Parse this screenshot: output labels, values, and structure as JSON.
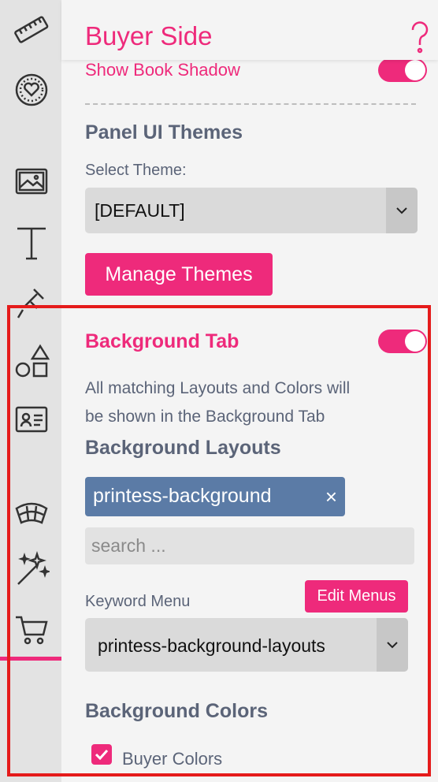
{
  "header": {
    "title": "Buyer Side"
  },
  "sidebar": {
    "icons": [
      "ruler-icon",
      "heart-badge-icon",
      "image-icon",
      "text-icon",
      "pin-icon",
      "shapes-icon",
      "id-card-icon",
      "arch-icon",
      "magic-wand-icon",
      "cart-icon"
    ],
    "active": "cart-icon"
  },
  "settings": {
    "book_shadow": {
      "label": "Show Book Shadow",
      "enabled": true
    },
    "panel_themes": {
      "title": "Panel UI Themes",
      "select_label": "Select Theme:",
      "selected": "[DEFAULT]",
      "manage_button": "Manage Themes"
    },
    "background_tab": {
      "label": "Background Tab",
      "enabled": true,
      "description_line1": "All matching Layouts and Colors will",
      "description_line2": "be shown in the Background Tab"
    },
    "background_layouts": {
      "title": "Background Layouts",
      "chip": "printess-background",
      "chip_remove": "×",
      "search_placeholder": "search ...",
      "keyword_menu_label": "Keyword Menu",
      "edit_menus_button": "Edit Menus",
      "keyword_selected": "printess-background-layouts"
    },
    "background_colors": {
      "title": "Background Colors",
      "buyer_colors_label": "Buyer Colors",
      "buyer_colors_checked": true
    }
  },
  "colors": {
    "accent": "#ee2a7b",
    "chip": "#5b7ba6",
    "section": "#5b6478",
    "highlight_frame": "#e51b1b"
  }
}
